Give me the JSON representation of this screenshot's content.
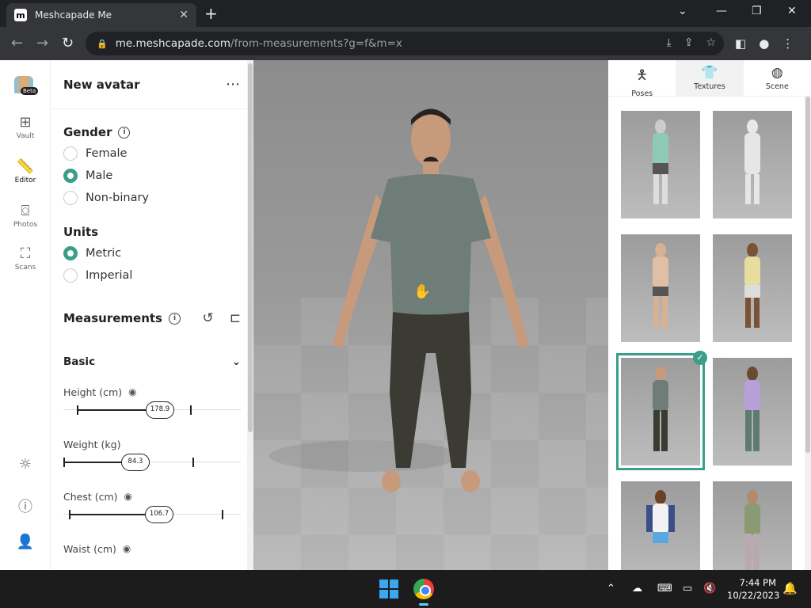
{
  "browser": {
    "tab_title": "Meshcapade Me",
    "url_host": "me.meshcapade.com",
    "url_path": "/from-measurements?g=f&m=x"
  },
  "rail": {
    "beta_label": "Beta",
    "items": [
      {
        "label": "Vault",
        "icon": "grid-icon"
      },
      {
        "label": "Editor",
        "icon": "ruler-icon"
      },
      {
        "label": "Photos",
        "icon": "camera-icon"
      },
      {
        "label": "Scans",
        "icon": "scan-icon"
      }
    ]
  },
  "panel": {
    "title": "New avatar",
    "gender": {
      "title": "Gender",
      "options": [
        "Female",
        "Male",
        "Non-binary"
      ],
      "selected": "Male"
    },
    "units": {
      "title": "Units",
      "options": [
        "Metric",
        "Imperial"
      ],
      "selected": "Metric"
    },
    "measurements_title": "Measurements",
    "basic_label": "Basic",
    "sliders": [
      {
        "label": "Height (cm)",
        "value": "178.9"
      },
      {
        "label": "Weight (kg)",
        "value": "84.3"
      },
      {
        "label": "Chest (cm)",
        "value": "106.7"
      },
      {
        "label": "Waist (cm)",
        "value": ""
      }
    ]
  },
  "right_panel": {
    "tabs": [
      {
        "label": "Poses",
        "icon": "person-pose-icon"
      },
      {
        "label": "Textures",
        "icon": "shirt-icon"
      },
      {
        "label": "Scene",
        "icon": "palette-icon"
      }
    ],
    "active_tab": "Textures"
  },
  "taskbar": {
    "time": "7:44 PM",
    "date": "10/22/2023"
  },
  "colors": {
    "accent": "#3a9e8a"
  }
}
